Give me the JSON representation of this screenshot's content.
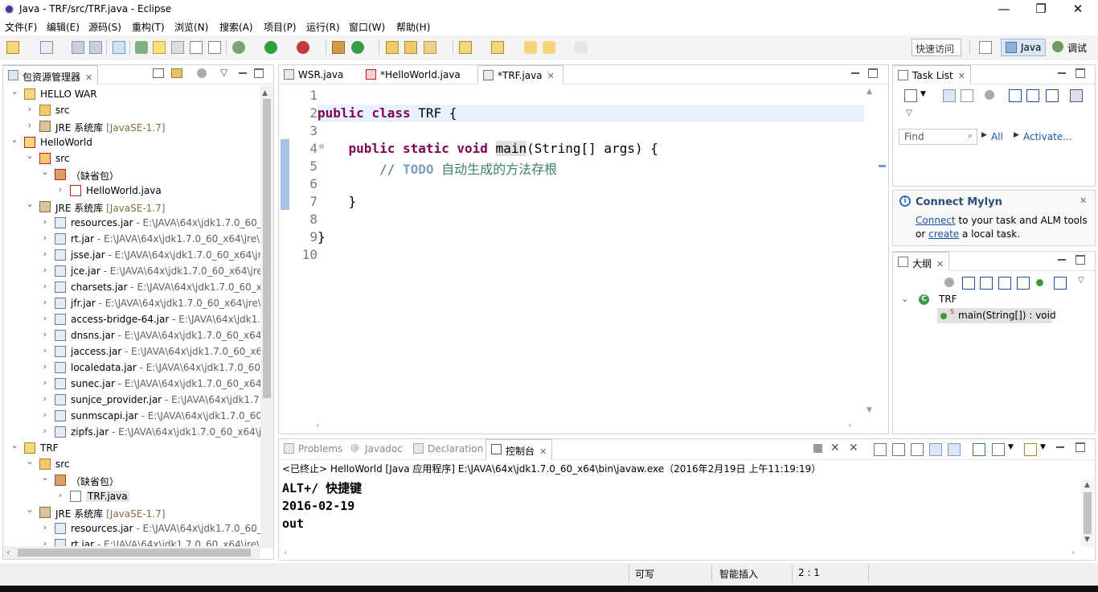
{
  "window": {
    "title": "Java - TRF/src/TRF.java - Eclipse",
    "controls": [
      "—",
      "❐",
      "✕"
    ]
  },
  "menu": [
    "文件(F)",
    "编辑(E)",
    "源码(S)",
    "重构(T)",
    "浏览(N)",
    "搜索(A)",
    "项目(P)",
    "运行(R)",
    "窗口(W)",
    "帮助(H)"
  ],
  "toolbar": {
    "quick_access": "快速访问",
    "perspectives": {
      "java": "Java",
      "debug": "调试"
    }
  },
  "package_explorer": {
    "title": "包资源管理器",
    "rows": [
      {
        "indent": 0,
        "chev": "⌄",
        "icon": "project-folder-icon",
        "label": "HELLO WAR",
        "suffix": ""
      },
      {
        "indent": 1,
        "chev": "›",
        "icon": "source-folder-icon",
        "label": "src",
        "suffix": ""
      },
      {
        "indent": 1,
        "chev": "›",
        "icon": "library-icon",
        "label": "JRE 系统库",
        "suffix": " [JavaSE-1.7]"
      },
      {
        "indent": 0,
        "chev": "⌄",
        "icon": "project-error-icon",
        "label": "HelloWorld",
        "suffix": ""
      },
      {
        "indent": 1,
        "chev": "⌄",
        "icon": "source-folder-error-icon",
        "label": "src",
        "suffix": ""
      },
      {
        "indent": 2,
        "chev": "⌄",
        "icon": "package-error-icon",
        "label": "（缺省包）",
        "suffix": ""
      },
      {
        "indent": 3,
        "chev": "›",
        "icon": "java-file-error-icon",
        "label": "HelloWorld.java",
        "suffix": ""
      },
      {
        "indent": 1,
        "chev": "⌄",
        "icon": "library-icon",
        "label": "JRE 系统库",
        "suffix": " [JavaSE-1.7]"
      },
      {
        "indent": 2,
        "chev": "›",
        "icon": "jar-icon",
        "label": "resources.jar",
        "suffix": " - E:\\JAVA\\64x\\jdk1.7.0_60_x"
      },
      {
        "indent": 2,
        "chev": "›",
        "icon": "jar-icon",
        "label": "rt.jar",
        "suffix": " - E:\\JAVA\\64x\\jdk1.7.0_60_x64\\jre\\li"
      },
      {
        "indent": 2,
        "chev": "›",
        "icon": "jar-icon",
        "label": "jsse.jar",
        "suffix": " - E:\\JAVA\\64x\\jdk1.7.0_60_x64\\jre"
      },
      {
        "indent": 2,
        "chev": "›",
        "icon": "jar-icon",
        "label": "jce.jar",
        "suffix": " - E:\\JAVA\\64x\\jdk1.7.0_60_x64\\jre\\"
      },
      {
        "indent": 2,
        "chev": "›",
        "icon": "jar-icon",
        "label": "charsets.jar",
        "suffix": " - E:\\JAVA\\64x\\jdk1.7.0_60_x6"
      },
      {
        "indent": 2,
        "chev": "›",
        "icon": "jar-icon",
        "label": "jfr.jar",
        "suffix": " - E:\\JAVA\\64x\\jdk1.7.0_60_x64\\jre\\l"
      },
      {
        "indent": 2,
        "chev": "›",
        "icon": "jar-icon",
        "label": "access-bridge-64.jar",
        "suffix": " - E:\\JAVA\\64x\\jdk1."
      },
      {
        "indent": 2,
        "chev": "›",
        "icon": "jar-icon",
        "label": "dnsns.jar",
        "suffix": " - E:\\JAVA\\64x\\jdk1.7.0_60_x64\\j"
      },
      {
        "indent": 2,
        "chev": "›",
        "icon": "jar-icon",
        "label": "jaccess.jar",
        "suffix": " - E:\\JAVA\\64x\\jdk1.7.0_60_x64"
      },
      {
        "indent": 2,
        "chev": "›",
        "icon": "jar-icon",
        "label": "localedata.jar",
        "suffix": " - E:\\JAVA\\64x\\jdk1.7.0_60_"
      },
      {
        "indent": 2,
        "chev": "›",
        "icon": "jar-icon",
        "label": "sunec.jar",
        "suffix": " - E:\\JAVA\\64x\\jdk1.7.0_60_x64\\j"
      },
      {
        "indent": 2,
        "chev": "›",
        "icon": "jar-icon",
        "label": "sunjce_provider.jar",
        "suffix": " - E:\\JAVA\\64x\\jdk1.7."
      },
      {
        "indent": 2,
        "chev": "›",
        "icon": "jar-icon",
        "label": "sunmscapi.jar",
        "suffix": " - E:\\JAVA\\64x\\jdk1.7.0_60_"
      },
      {
        "indent": 2,
        "chev": "›",
        "icon": "jar-icon",
        "label": "zipfs.jar",
        "suffix": " - E:\\JAVA\\64x\\jdk1.7.0_60_x64\\jr"
      },
      {
        "indent": 0,
        "chev": "⌄",
        "icon": "project-folder-icon",
        "label": "TRF",
        "suffix": ""
      },
      {
        "indent": 1,
        "chev": "⌄",
        "icon": "source-folder-icon",
        "label": "src",
        "suffix": ""
      },
      {
        "indent": 2,
        "chev": "⌄",
        "icon": "package-icon",
        "label": "（缺省包）",
        "suffix": ""
      },
      {
        "indent": 3,
        "chev": "›",
        "icon": "java-file-icon",
        "label": "TRF.java",
        "suffix": ""
      },
      {
        "indent": 1,
        "chev": "⌄",
        "icon": "library-icon",
        "label": "JRE 系统库",
        "suffix": " [JavaSE-1.7]"
      },
      {
        "indent": 2,
        "chev": "›",
        "icon": "jar-icon",
        "label": "resources.jar",
        "suffix": " - E:\\JAVA\\64x\\jdk1.7.0_60_x"
      },
      {
        "indent": 2,
        "chev": "›",
        "icon": "jar-icon",
        "label": "rt.jar",
        "suffix": " - E:\\JAVA\\64x\\jdk1.7.0_60_x64\\jre\\li"
      }
    ]
  },
  "editor": {
    "tabs": [
      {
        "label": "WSR.java",
        "icon": "java-file-icon",
        "active": false
      },
      {
        "label": "*HelloWorld.java",
        "icon": "java-file-error-icon",
        "active": false
      },
      {
        "label": "*TRF.java",
        "icon": "java-file-icon",
        "active": true
      }
    ],
    "line_numbers": [
      "1",
      "2",
      "3",
      "4",
      "5",
      "6",
      "7",
      "8",
      "9",
      "10"
    ],
    "code": {
      "l2_kw": "public class",
      "l2_rest": " TRF {",
      "l4_indent": "    ",
      "l4_kw": "public static void",
      "l4_main": "main",
      "l4_rest": "(String[] args) {",
      "l5_indent": "        ",
      "l5_comment": "// ",
      "l5_todo": "TODO",
      "l5_text": " 自动生成的方法存根",
      "l7_brace": "    }",
      "l9_brace": "}"
    }
  },
  "task_list": {
    "title": "Task List",
    "find_placeholder": "Find",
    "all": "All",
    "activate": "Activate..."
  },
  "mylyn": {
    "title": "Connect Mylyn",
    "connect_link": "Connect",
    "text1": " to your task and ALM tools",
    "text2_pre": "or ",
    "create_link": "create",
    "text2_post": " a local task."
  },
  "outline": {
    "title": "大纲",
    "class_name": "TRF",
    "method": "main(String[]) : void"
  },
  "bottom": {
    "tabs": [
      "Problems",
      "Javadoc",
      "Declaration",
      "控制台"
    ],
    "console_header": "<已终止> HelloWorld [Java 应用程序] E:\\JAVA\\64x\\jdk1.7.0_60_x64\\bin\\javaw.exe（2016年2月19日 上午11:19:19）",
    "console_lines": [
      "ALT+/ 快捷键",
      "2016-02-19",
      "out"
    ]
  },
  "status": {
    "writable": "可写",
    "insert_mode": "智能插入",
    "position": "2 : 1"
  }
}
